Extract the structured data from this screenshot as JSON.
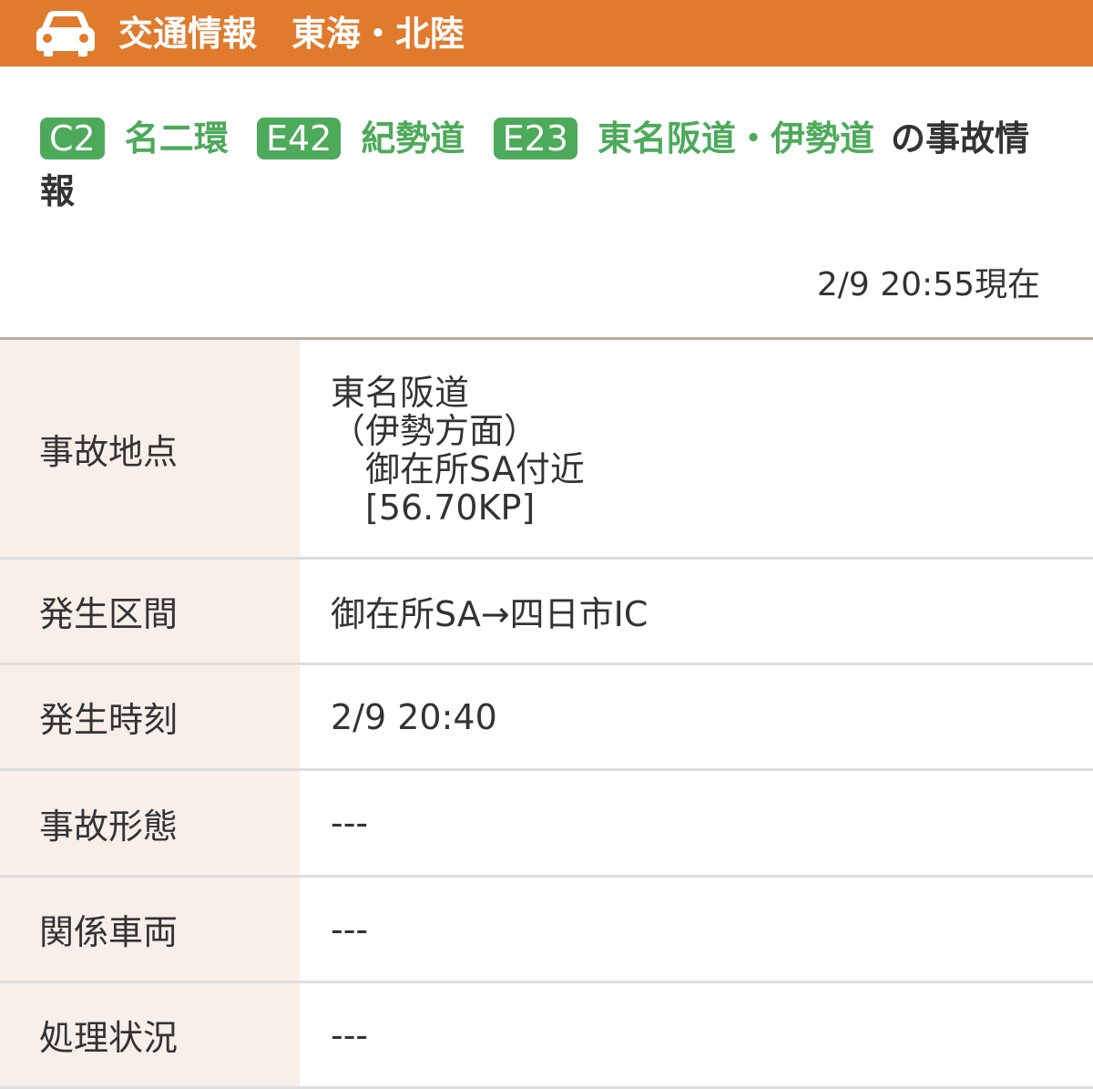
{
  "header": {
    "icon": "car-icon",
    "title": "交通情報　東海・北陸",
    "color": "#e07b2e"
  },
  "intro": {
    "routes": [
      {
        "code": "C2",
        "name": "名二環"
      },
      {
        "code": "E42",
        "name": "紀勢道"
      },
      {
        "code": "E23",
        "name": "東名阪道・伊勢道"
      }
    ],
    "suffix": "の事故情報",
    "timestamp": "2/9 20:55現在",
    "badge_color": "#4caa5a"
  },
  "details": {
    "location": {
      "label": "事故地点",
      "lines": [
        "東名阪道",
        "（伊勢方面）",
        "　御在所SA付近",
        "　[56.70KP]"
      ]
    },
    "section": {
      "label": "発生区間",
      "value": "御在所SA→四日市IC"
    },
    "time": {
      "label": "発生時刻",
      "value": "2/9 20:40"
    },
    "type": {
      "label": "事故形態",
      "value": "---"
    },
    "vehicles": {
      "label": "関係車両",
      "value": "---"
    },
    "status": {
      "label": "処理状況",
      "value": "---"
    }
  }
}
